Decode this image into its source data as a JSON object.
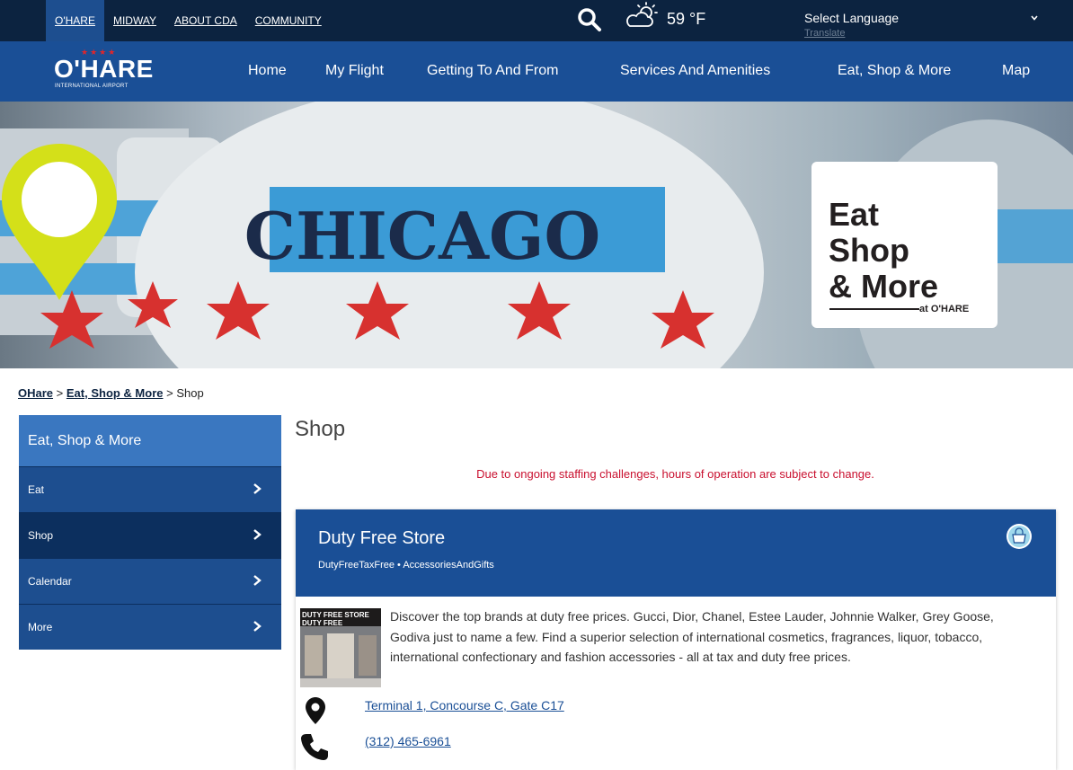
{
  "utility_nav": {
    "links": [
      "O'HARE",
      "MIDWAY",
      "ABOUT CDA",
      "COMMUNITY"
    ],
    "active": "O'HARE"
  },
  "weather": {
    "icon": "partly-cloudy-icon",
    "temperature": "59 °F"
  },
  "language": {
    "selected": "Select Language",
    "translate_label": "Translate"
  },
  "logo": {
    "name": "O'HARE",
    "subtitle": "INTERNATIONAL AIRPORT"
  },
  "main_nav": {
    "items": [
      "Home",
      "My Flight",
      "Getting To And From",
      "Services And Amenities",
      "Eat, Shop & More",
      "Map"
    ]
  },
  "hero": {
    "badge_lines": [
      "Eat",
      "Shop",
      "& More"
    ],
    "badge_at": "at O'HARE",
    "banner_text": "CHICAGO"
  },
  "breadcrumb": {
    "items": [
      {
        "label": "OHare",
        "link": true
      },
      {
        "label": "Eat, Shop & More",
        "link": true
      },
      {
        "label": "Shop",
        "link": false
      }
    ],
    "separator": ">"
  },
  "sidebar": {
    "heading": "Eat, Shop & More",
    "items": [
      {
        "label": "Eat",
        "active": false
      },
      {
        "label": "Shop",
        "active": true
      },
      {
        "label": "Calendar",
        "active": false
      },
      {
        "label": "More",
        "active": false
      }
    ]
  },
  "content": {
    "title": "Shop",
    "notice": "Due to ongoing staffing challenges, hours of operation are subject to change."
  },
  "store": {
    "name": "Duty Free Store",
    "categories": "DutyFreeTaxFree • AccessoriesAndGifts",
    "thumbnail_text": "DUTY FREE STORE DUTY FREE",
    "description": "Discover the top brands at duty free prices. Gucci, Dior, Chanel, Estee Lauder, Johnnie Walker, Grey Goose, Godiva just to name a few. Find a superior selection of international cosmetics, fragrances, liquor, tobacco, international confectionary and fashion accessories - all at tax and duty free prices.",
    "location": "Terminal 1, Concourse C, Gate C17",
    "phone": "(312) 465-6961",
    "category_icon": "shopping-bag-icon"
  },
  "colors": {
    "topbar": "#0c2340",
    "nav": "#1a4f96",
    "sidebar_head": "#3a77c0",
    "notice": "#c9102f",
    "pin": "#d4e019"
  }
}
